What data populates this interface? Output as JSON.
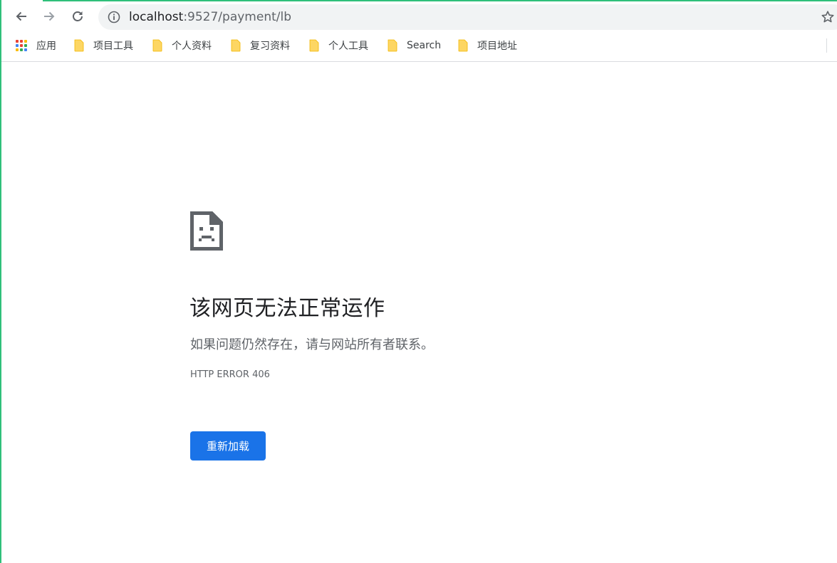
{
  "browser": {
    "url_host": "localhost",
    "url_path": ":9527/payment/lb"
  },
  "bookmarks": [
    {
      "label": "应用",
      "icon": "apps-grid-icon"
    },
    {
      "label": "项目工具",
      "icon": "folder-icon"
    },
    {
      "label": "个人资料",
      "icon": "folder-icon"
    },
    {
      "label": "复习资料",
      "icon": "folder-icon"
    },
    {
      "label": "个人工具",
      "icon": "folder-icon"
    },
    {
      "label": "Search",
      "icon": "folder-icon"
    },
    {
      "label": "项目地址",
      "icon": "folder-icon"
    }
  ],
  "error_page": {
    "title": "该网页无法正常运作",
    "subtitle": "如果问题仍然存在，请与网站所有者联系。",
    "code": "HTTP ERROR 406",
    "reload_label": "重新加载"
  },
  "colors": {
    "accent": "#1a73e8",
    "folder": "#fdd663",
    "window_edge": "#2fbf7a"
  }
}
